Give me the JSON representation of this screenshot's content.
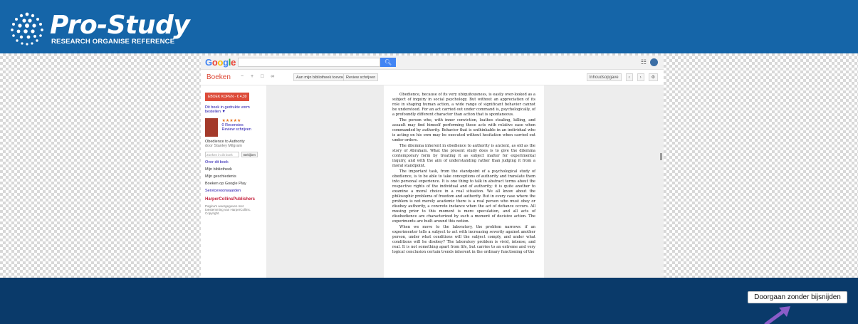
{
  "brand": {
    "title": "Pro-Study",
    "subtitle": "RESEARCH ORGANISE REFERENCE"
  },
  "embedded": {
    "google_logo": [
      "G",
      "o",
      "o",
      "g",
      "l",
      "e"
    ],
    "search_button_icon": "search-icon",
    "books_label": "Boeken",
    "toolbar_buttons": [
      "Aan mijn bibliotheek toevoegen",
      "Review schrijven"
    ],
    "toolbar_right": "Inhoudsopgave",
    "sidebar": {
      "buy": "EBOEK KOPEN - € 4,39",
      "link": "Dit boek in gedrukte vorm bestellen ▼",
      "stars": "★★★★★",
      "reviews_line1": "0 Recensies",
      "reviews_line2": "Review schrijven",
      "book_title": "Obedience to Authority",
      "author": "door Stanley Milgram",
      "search_placeholder": "Zoeken in dit boek",
      "search_btn": "Bekijken",
      "about": "Over dit boek",
      "my_library": "Mijn bibliotheek",
      "my_history": "Mijn geschiedenis",
      "play": "Boeken op Google Play",
      "voorwaarden": "Servicevoorwaarden",
      "publisher": "HarperCollinsPublishers",
      "pages_note": "Pagina's weergegeven met toestemming van HarperCollins. Copyright."
    },
    "page_text": [
      "Obedience, because of its very ubiquitousness, is easily over-looked as a subject of inquiry in social psychology. But without an appreciation of its role in shaping human action, a wide range of significant behavior cannot be understood. For an act carried out under command is, psychologically, of a profoundly different character than action that is spontaneous.",
      "The person who, with inner conviction, loathes stealing, killing, and assault may find himself performing these acts with relative ease when commanded by authority. Behavior that is unthinkable in an individual who is acting on his own may be executed without hesitation when carried out under orders.",
      "The dilemma inherent in obedience to authority is ancient, as old as the story of Abraham. What the present study does is to give the dilemma contemporary form by treating it as subject matter for experimental inquiry, and with the aim of understanding rather than judging it from a moral standpoint.",
      "The important task, from the standpoint of a psychological study of obedience, is to be able to take conceptions of authority and translate them into personal experience. It is one thing to talk in abstract terms about the respective rights of the individual and of authority; it is quite another to examine a moral choice in a real situation. We all know about the philosophic problems of freedom and authority. But in every case where the problem is not merely academic there is a real person who must obey or disobey authority, a concrete instance when the act of defiance occurs. All musing prior to this moment is mere speculation, and all acts of disobedience are characterized by such a moment of decisive action. The experiments are built around this notion.",
      "When we move to the laboratory, the problem narrows: if an experimenter tells a subject to act with increasing severity against another person, under what conditions will the subject comply, and under what conditions will he disobey? The laboratory problem is vivid, intense, and real. It is not something apart from life, but carries to an extreme and very logical conclusion certain trends inherent in the ordinary functioning of the"
    ]
  },
  "actions": {
    "continue_label": "Doorgaan zonder bijsnijden"
  },
  "colors": {
    "header": "#1565a8",
    "bottom": "#0a3a6a",
    "arrow": "#8a5cc8"
  }
}
